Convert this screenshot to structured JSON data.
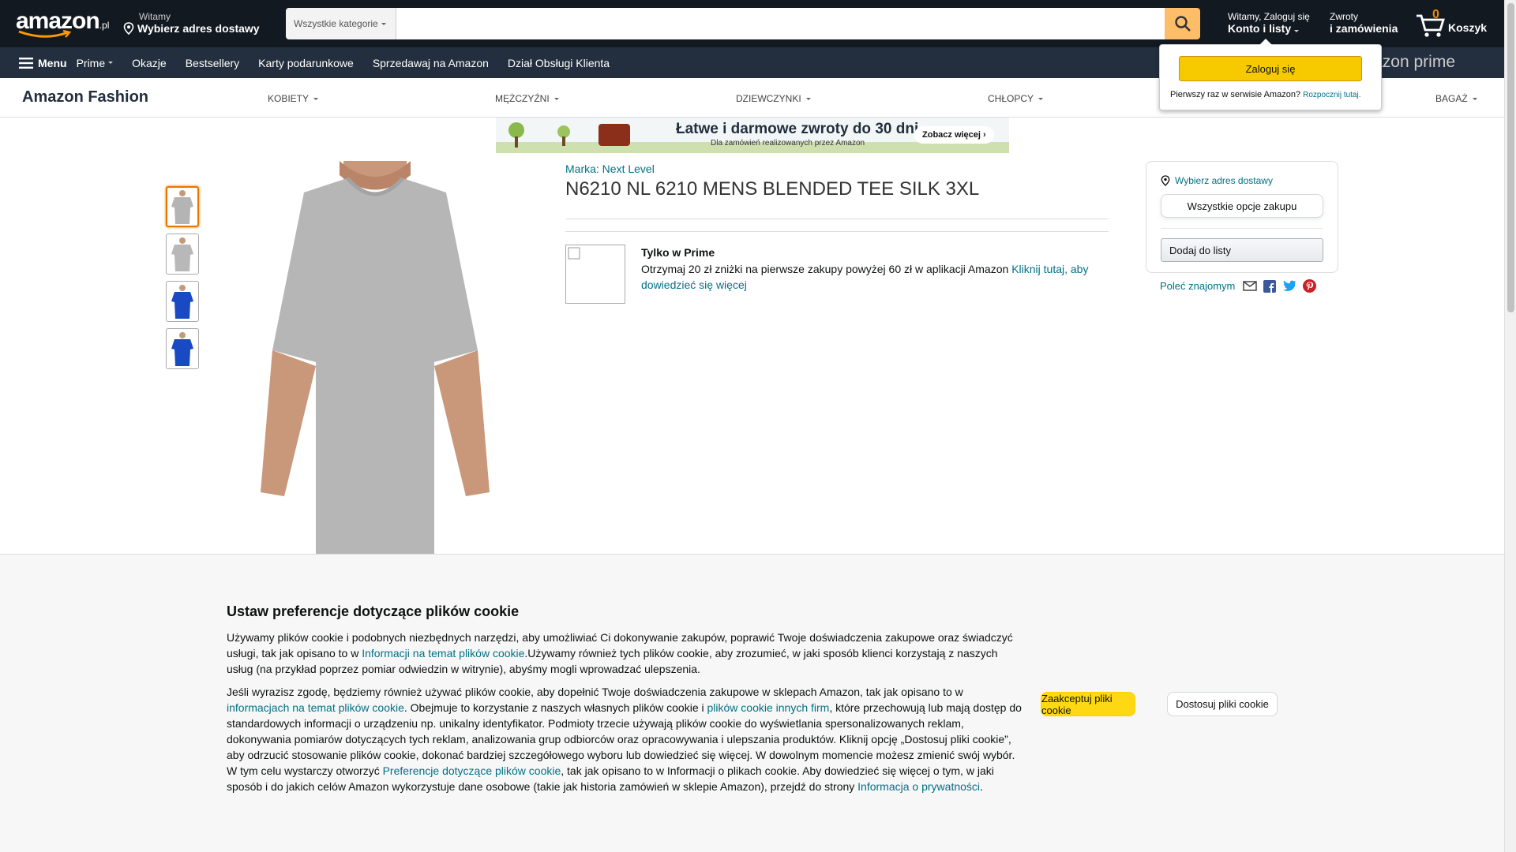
{
  "header": {
    "logo": "amazon",
    "logo_tld": ".pl",
    "deliver_small": "Witamy",
    "deliver_big": "Wybierz adres dostawy",
    "search_category": "Wszystkie kategorie",
    "search_placeholder": "",
    "account_small": "Witamy, Zaloguj się",
    "account_big": "Konto i listy",
    "returns_small": "Zwroty",
    "returns_big": "i zamówienia",
    "cart_count": "0",
    "cart_label": "Koszyk"
  },
  "nav": {
    "menu_label": "Menu",
    "items": [
      "Prime",
      "Okazje",
      "Bestsellery",
      "Karty podarunkowe",
      "Sprzedawaj na Amazon",
      "Dział Obsługi Klienta"
    ],
    "prime_logo": "Amazon prime"
  },
  "flyout": {
    "signin_button": "Zaloguj się",
    "new_customer": "Pierwszy raz w serwisie Amazon?",
    "start_link": "Rozpocznij tutaj."
  },
  "fashion": {
    "logo": "Amazon Fashion",
    "categories": [
      "KOBIETY",
      "MĘŻCZYŹNI",
      "DZIEWCZYNKI",
      "CHŁOPCY",
      "BAGAŻ"
    ]
  },
  "banner": {
    "title": "Łatwe i darmowe zwroty do 30 dni",
    "subtitle": "Dla zamówień realizowanych przez Amazon",
    "cta": "Zobacz więcej ›"
  },
  "product": {
    "brand": "Marka: Next Level",
    "title": "N6210 NL 6210 MENS BLENDED TEE SILK 3XL",
    "thumbnails": [
      "grey-front",
      "grey-front-alt",
      "blue-front",
      "blue-back"
    ],
    "colors": {
      "grey": "#b8b8b8",
      "blue": "#1a49c4"
    }
  },
  "prime_offer": {
    "heading": "Tylko w Prime",
    "text": "Otrzymaj 20 zł zniżki na pierwsze zakupy powyżej 60 zł w aplikacji Amazon ",
    "link": "Kliknij tutaj, aby dowiedzieć się więcej"
  },
  "buybox": {
    "location": "Wybierz adres dostawy",
    "all_options": "Wszystkie opcje zakupu",
    "add_to_list": "Dodaj do listy"
  },
  "share": {
    "label": "Poleć znajomym",
    "icons": [
      "email-icon",
      "facebook-icon",
      "twitter-icon",
      "pinterest-icon"
    ]
  },
  "cookie": {
    "title": "Ustaw preferencje dotyczące plików cookie",
    "p1_a": "Używamy plików cookie i podobnych niezbędnych narzędzi, aby umożliwiać Ci dokonywanie zakupów, poprawić Twoje doświadczenia zakupowe oraz świadczyć usługi, tak jak opisano to w ",
    "p1_link": "Informacji na temat plików cookie",
    "p1_b": ".Używamy również tych plików cookie, aby zrozumieć, w jaki sposób klienci korzystają z naszych usług (na przykład poprzez pomiar odwiedzin w witrynie), abyśmy mogli wprowadzać ulepszenia.",
    "p2_a": "Jeśli wyrazisz zgodę, będziemy również używać plików cookie, aby dopełnić Twoje doświadczenia zakupowe w sklepach Amazon, tak jak opisano to w ",
    "p2_link1": "informacjach na temat plików cookie",
    "p2_b": ". Obejmuje to korzystanie z naszych własnych plików cookie i ",
    "p2_link2": "plików cookie innych firm",
    "p2_c": ", które przechowują lub mają dostęp do standardowych informacji o urządzeniu np. unikalny identyfikator. Podmioty trzecie używają plików cookie do wyświetlania spersonalizowanych reklam, dokonywania pomiarów dotyczących tych reklam, analizowania grup odbiorców oraz opracowywania i ulepszania produktów. Kliknij opcję „Dostosuj pliki cookie”, aby odrzucić stosowanie plików cookie, dokonać bardziej szczegółowego wyboru lub dowiedzieć się więcej. W dowolnym momencie możesz zmienić swój wybór. W tym celu wystarczy otworzyć ",
    "p2_link3": "Preferencje dotyczące plików cookie",
    "p2_d": ", tak jak opisano to w Informacji o plikach cookie. Aby dowiedzieć się więcej o tym, w jaki sposób i do jakich celów Amazon wykorzystuje dane osobowe (takie jak historia zamówień w sklepie Amazon), przejdź do strony ",
    "p2_link4": "Informacja o prywatności",
    "p2_e": ".",
    "accept": "Zaakceptuj pliki cookie",
    "customize": "Dostosuj pliki cookie"
  }
}
